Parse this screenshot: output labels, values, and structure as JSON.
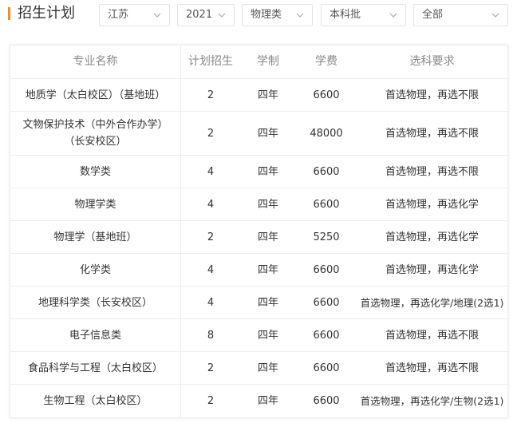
{
  "header": {
    "title": "招生计划",
    "accent_color": "#f28c1f",
    "filters": [
      {
        "value": "江苏"
      },
      {
        "value": "2021"
      },
      {
        "value": "物理类"
      },
      {
        "value": "本科批"
      },
      {
        "value": "全部"
      }
    ]
  },
  "table": {
    "columns": [
      "专业名称",
      "计划招生",
      "学制",
      "学费",
      "选科要求"
    ],
    "rows": [
      {
        "major": "地质学（太白校区）（基地班）",
        "plan": "2",
        "duration": "四年",
        "tuition": "6600",
        "requirement": "首选物理，再选不限"
      },
      {
        "major": "文物保护技术（中外合作办学）（长安校区）",
        "plan": "2",
        "duration": "四年",
        "tuition": "48000",
        "requirement": "首选物理，再选不限"
      },
      {
        "major": "数学类",
        "plan": "4",
        "duration": "四年",
        "tuition": "6600",
        "requirement": "首选物理，再选不限"
      },
      {
        "major": "物理学类",
        "plan": "4",
        "duration": "四年",
        "tuition": "6600",
        "requirement": "首选物理，再选化学"
      },
      {
        "major": "物理学（基地班）",
        "plan": "2",
        "duration": "四年",
        "tuition": "5250",
        "requirement": "首选物理，再选化学"
      },
      {
        "major": "化学类",
        "plan": "4",
        "duration": "四年",
        "tuition": "6600",
        "requirement": "首选物理，再选化学"
      },
      {
        "major": "地理科学类（长安校区）",
        "plan": "4",
        "duration": "四年",
        "tuition": "6600",
        "requirement": "首选物理，再选化学/地理(2选1)"
      },
      {
        "major": "电子信息类",
        "plan": "8",
        "duration": "四年",
        "tuition": "6600",
        "requirement": "首选物理，再选不限"
      },
      {
        "major": "食品科学与工程（太白校区）",
        "plan": "2",
        "duration": "四年",
        "tuition": "6600",
        "requirement": "首选物理，再选不限"
      },
      {
        "major": "生物工程（太白校区）",
        "plan": "2",
        "duration": "四年",
        "tuition": "6600",
        "requirement": "首选物理，再选化学/生物(2选1)"
      }
    ]
  }
}
